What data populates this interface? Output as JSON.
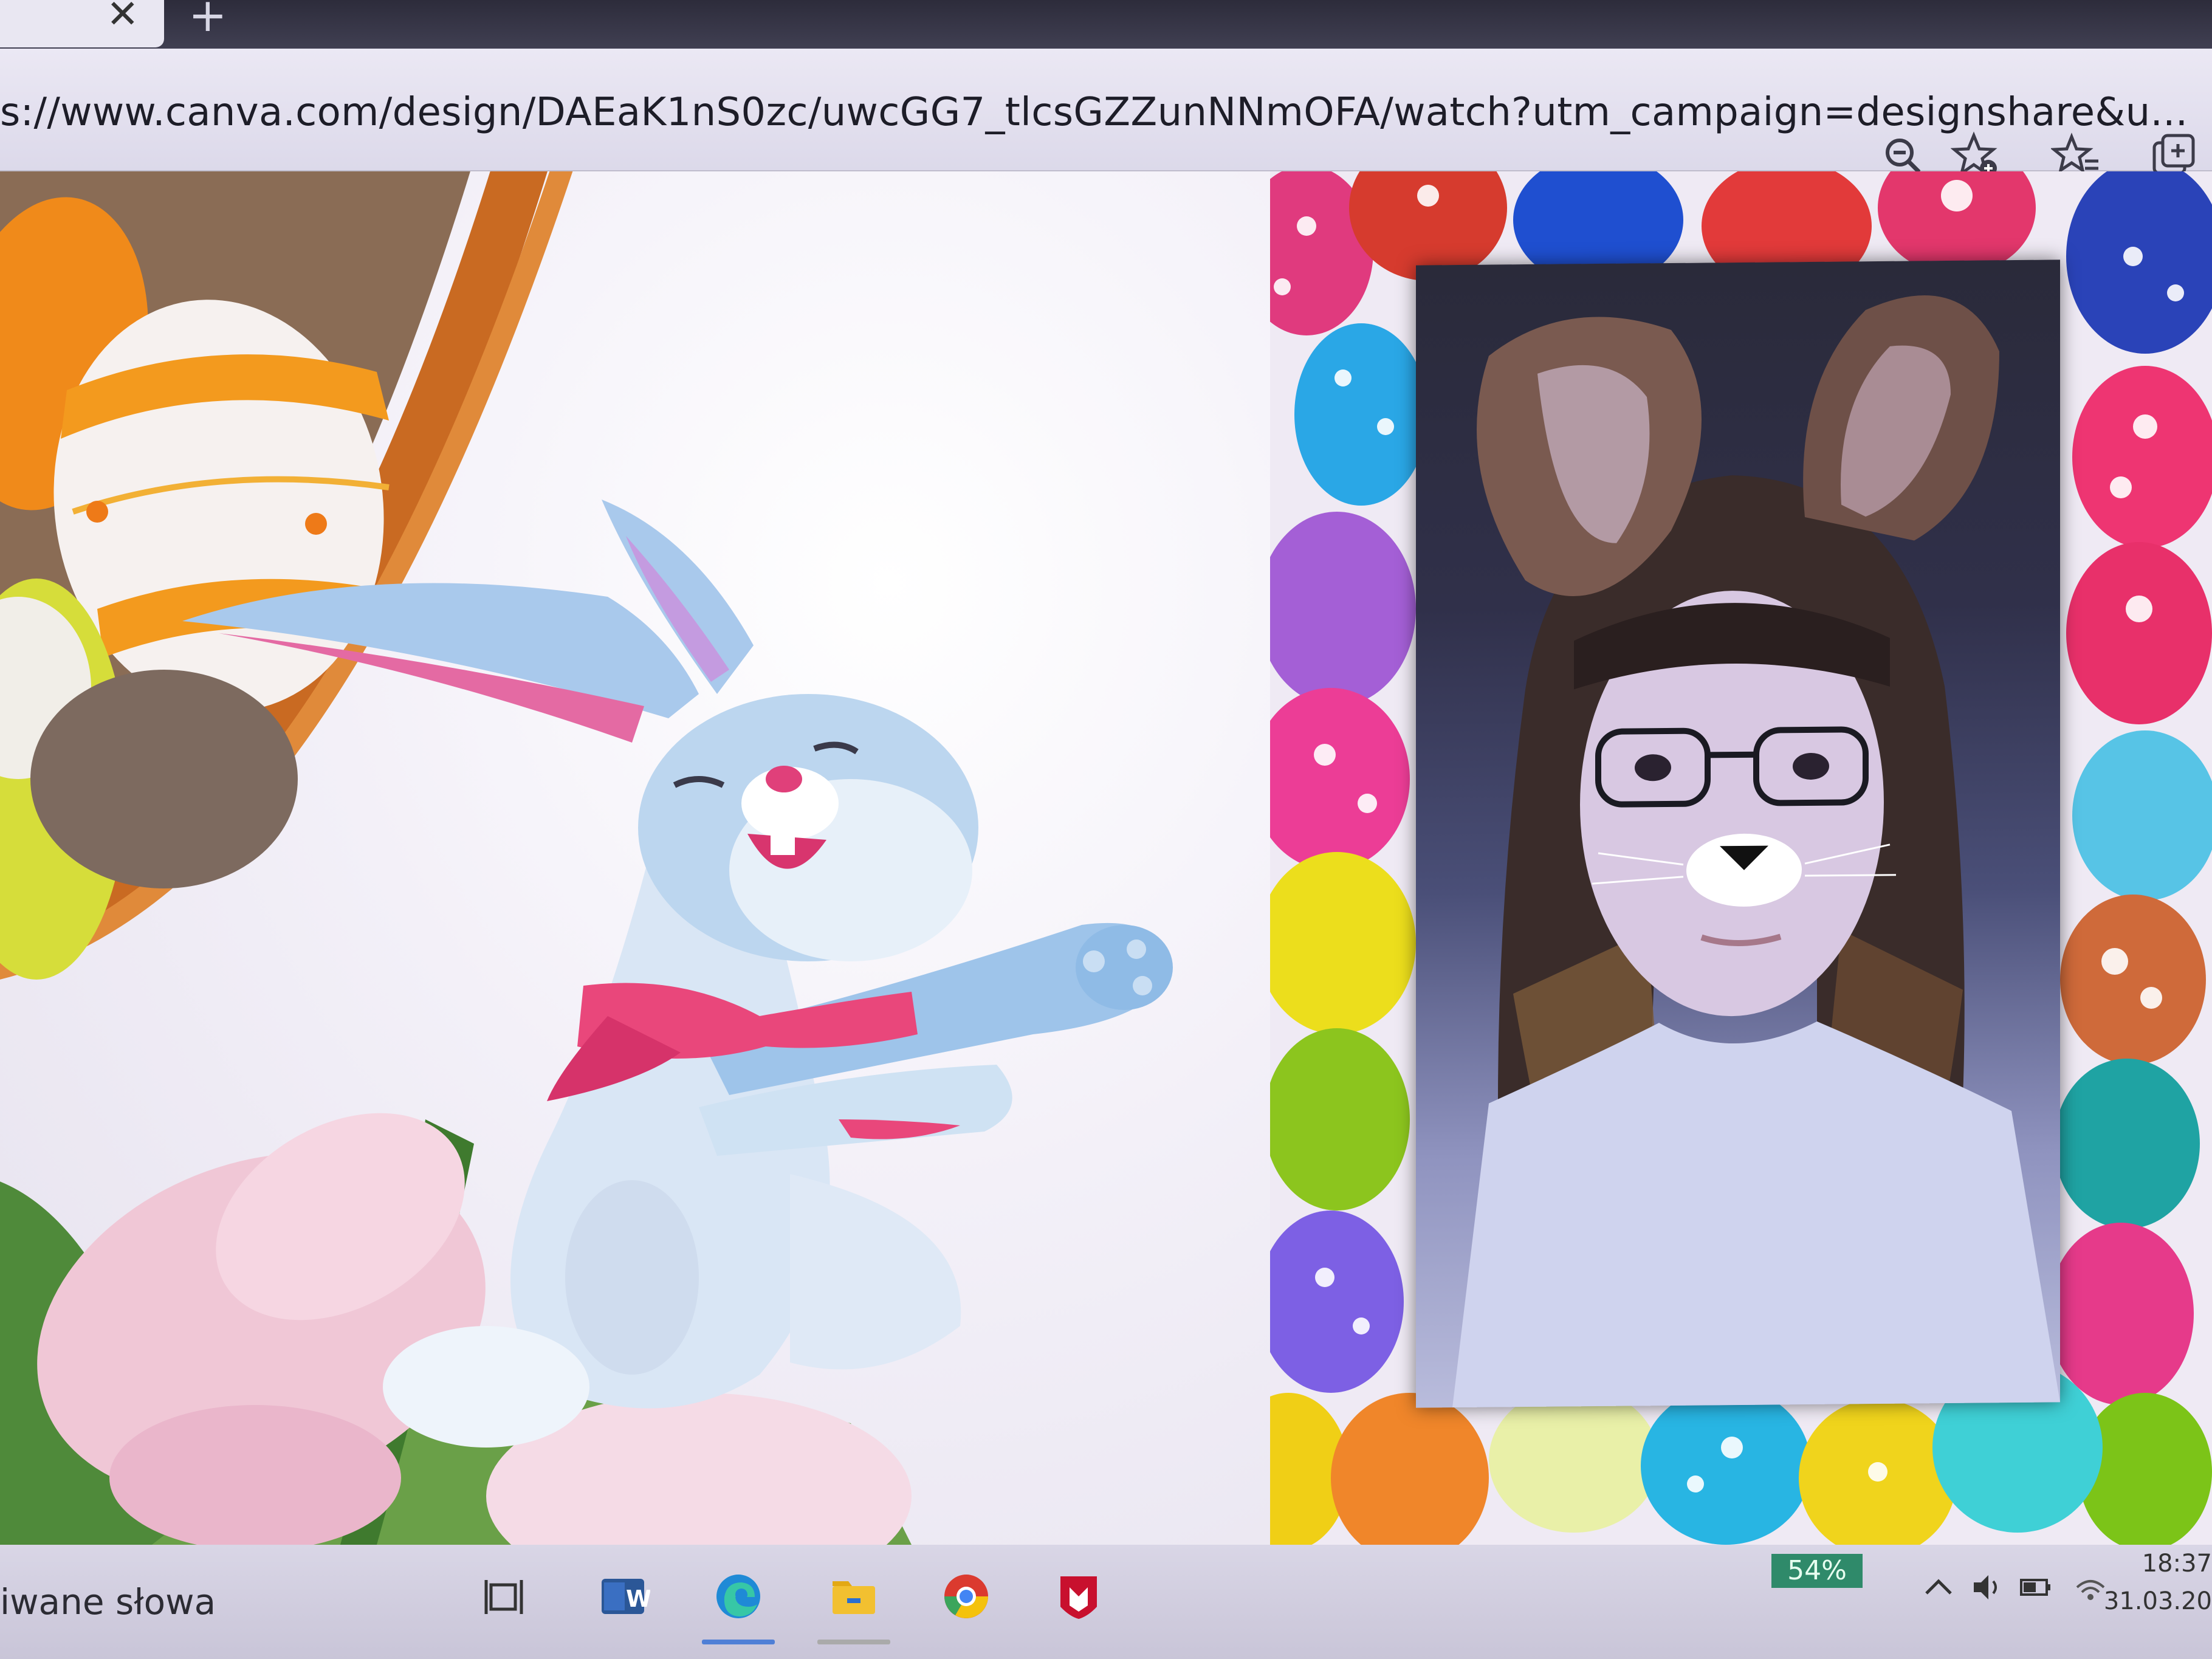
{
  "browser": {
    "tab_close": "✕",
    "new_tab": "+",
    "url": "s://www.canva.com/design/DAEaK1nS0zc/uwcGG7_tlcsGZZunNNmOFA/watch?utm_campaign=designshare&u..."
  },
  "icons": {
    "zoom": "zoom-out-icon",
    "favorite_add": "add-favorite-icon",
    "favorites": "favorites-icon",
    "collections": "collections-icon"
  },
  "taskbar": {
    "search_text": "iwane słowa",
    "apps": [
      "task-view",
      "word",
      "edge",
      "file-explorer",
      "chrome",
      "mcafee"
    ]
  },
  "tray": {
    "battery_badge": "54%",
    "time": "18:37",
    "date": "31.03.20"
  },
  "colors": {
    "accent_blue": "#4f7fd6",
    "badge_green": "#2f8a6a",
    "bunny_blue": "#a9c9ec",
    "scarf_pink": "#e9477b"
  }
}
